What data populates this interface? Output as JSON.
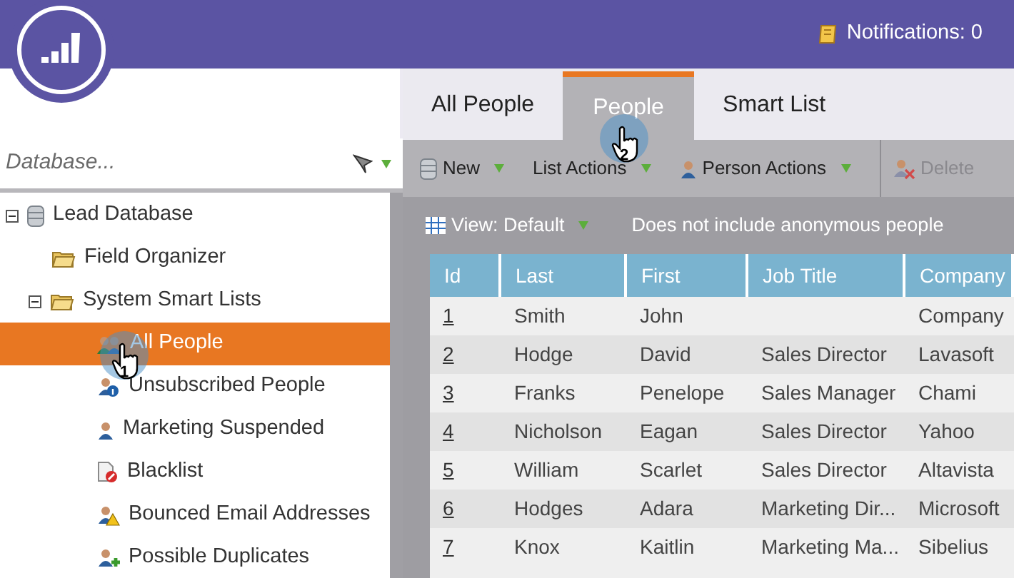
{
  "header": {
    "notifications": "Notifications: 0"
  },
  "sidebar": {
    "search": {
      "placeholder": "Database..."
    },
    "tree": [
      {
        "label": "Lead Database",
        "kind": "database",
        "selected": false,
        "expanded": true,
        "children": [
          {
            "label": "Field Organizer",
            "kind": "folder",
            "selected": false
          },
          {
            "label": "System Smart Lists",
            "kind": "folder",
            "selected": false,
            "expanded": true,
            "children": [
              {
                "label": "All People",
                "kind": "people",
                "selected": true
              },
              {
                "label": "Unsubscribed People",
                "kind": "person-info",
                "selected": false
              },
              {
                "label": "Marketing Suspended",
                "kind": "person",
                "selected": false
              },
              {
                "label": "Blacklist",
                "kind": "blacklist",
                "selected": false
              },
              {
                "label": "Bounced Email Addresses",
                "kind": "person-warning",
                "selected": false
              },
              {
                "label": "Possible Duplicates",
                "kind": "person-add",
                "selected": false
              }
            ]
          }
        ]
      }
    ]
  },
  "tabs": [
    {
      "label": "All People",
      "selected": false
    },
    {
      "label": "People",
      "selected": true
    },
    {
      "label": "Smart List",
      "selected": false
    }
  ],
  "toolbar": [
    {
      "label": "New",
      "kind": "database",
      "disabled": false
    },
    {
      "label": "List Actions",
      "kind": "none",
      "disabled": false
    },
    {
      "label": "Person Actions",
      "kind": "person",
      "disabled": false
    },
    {
      "label": "Delete",
      "kind": "delete",
      "disabled": true
    }
  ],
  "view": {
    "label": "View: Default",
    "note": "Does not include anonymous people"
  },
  "table": {
    "columns": [
      "Id",
      "Last",
      "First",
      "Job Title",
      "Company"
    ],
    "rows": [
      [
        "1",
        "Smith",
        "John",
        "",
        "Company"
      ],
      [
        "2",
        "Hodge",
        "David",
        "Sales Director",
        "Lavasoft"
      ],
      [
        "3",
        "Franks",
        "Penelope",
        "Sales Manager",
        "Chami"
      ],
      [
        "4",
        "Nicholson",
        "Eagan",
        "Sales Director",
        "Yahoo"
      ],
      [
        "5",
        "William",
        "Scarlet",
        "Sales Director",
        "Altavista"
      ],
      [
        "6",
        "Hodges",
        "Adara",
        "Marketing Dir...",
        "Microsoft"
      ],
      [
        "7",
        "Knox",
        "Kaitlin",
        "Marketing Ma...",
        "Sibelius"
      ]
    ]
  },
  "callouts": [
    {
      "number": "1"
    },
    {
      "number": "2"
    }
  ]
}
